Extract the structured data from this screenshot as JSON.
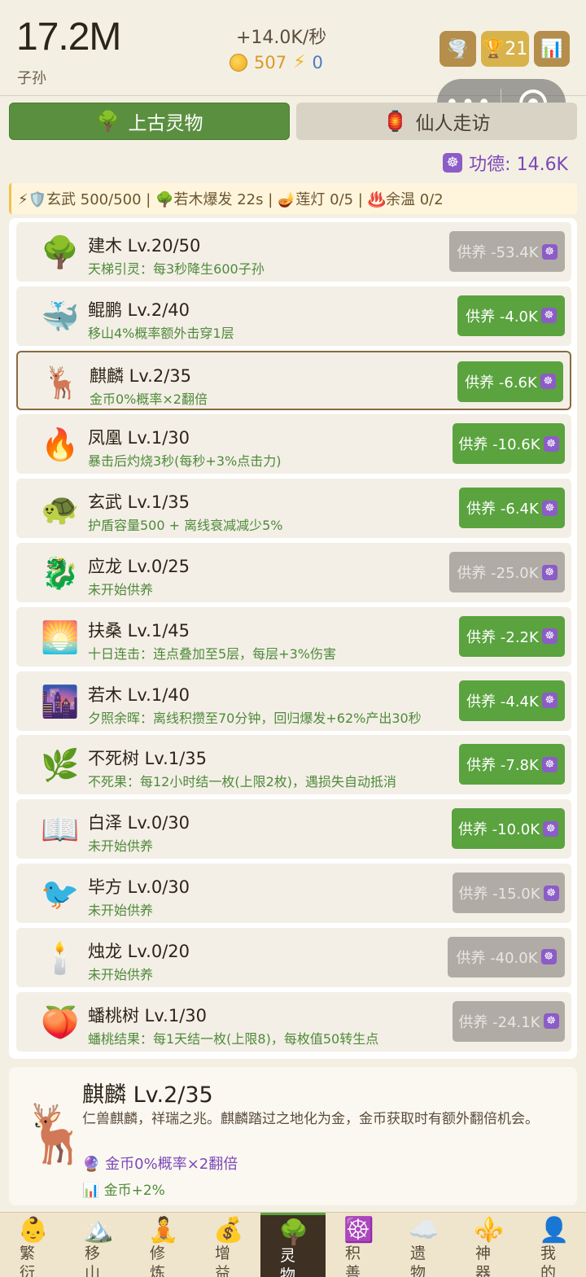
{
  "header": {
    "total": "17.2M",
    "total_label": "子孙",
    "rate": "+14.0K/秒",
    "coins": "507",
    "energy": "0",
    "trophy_count": "21"
  },
  "capsule": {
    "menu_dots": "•••"
  },
  "tabs": [
    {
      "label": "上古灵物",
      "emoji": "🌳"
    },
    {
      "label": "仙人走访",
      "emoji": "🏮"
    }
  ],
  "merit": {
    "label": "功德: 14.6K"
  },
  "status_bar": "⚡🛡️玄武 500/500 | 🌳若木爆发 22s | 🪔莲灯 0/5 | ♨️余温 0/2",
  "items": [
    {
      "emoji": "🌳",
      "name": "建木 Lv.20/50",
      "desc": "天梯引灵：每3秒降生600子孙",
      "button": "供养 -53.4K",
      "enabled": false
    },
    {
      "emoji": "🐳",
      "name": "鲲鹏 Lv.2/40",
      "desc": "移山4%概率额外击穿1层",
      "button": "供养 -4.0K",
      "enabled": true
    },
    {
      "emoji": "🦌",
      "name": "麒麟 Lv.2/35",
      "desc": "金币0%概率×2翻倍",
      "button": "供养 -6.6K",
      "enabled": true,
      "selected": true
    },
    {
      "emoji": "🔥",
      "name": "凤凰 Lv.1/30",
      "desc": "暴击后灼烧3秒(每秒+3%点击力)",
      "button": "供养 -10.6K",
      "enabled": true
    },
    {
      "emoji": "🐢",
      "name": "玄武 Lv.1/35",
      "desc": "护盾容量500 + 离线衰减减少5%",
      "button": "供养 -6.4K",
      "enabled": true
    },
    {
      "emoji": "🐉",
      "name": "应龙 Lv.0/25",
      "desc": "未开始供养",
      "button": "供养 -25.0K",
      "enabled": false
    },
    {
      "emoji": "🌅",
      "name": "扶桑 Lv.1/45",
      "desc": "十日连击：连点叠加至5层，每层+3%伤害",
      "button": "供养 -2.2K",
      "enabled": true
    },
    {
      "emoji": "🌆",
      "name": "若木 Lv.1/40",
      "desc": "夕照余晖：离线积攒至70分钟，回归爆发+62%产出30秒",
      "button": "供养 -4.4K",
      "enabled": true
    },
    {
      "emoji": "🌿",
      "name": "不死树 Lv.1/35",
      "desc": "不死果：每12小时结一枚(上限2枚)，遇损失自动抵消",
      "button": "供养 -7.8K",
      "enabled": true
    },
    {
      "emoji": "📖",
      "name": "白泽 Lv.0/30",
      "desc": "未开始供养",
      "button": "供养 -10.0K",
      "enabled": true
    },
    {
      "emoji": "🐦",
      "name": "毕方 Lv.0/30",
      "desc": "未开始供养",
      "button": "供养 -15.0K",
      "enabled": false
    },
    {
      "emoji": "🕯️",
      "name": "烛龙 Lv.0/20",
      "desc": "未开始供养",
      "button": "供养 -40.0K",
      "enabled": false
    },
    {
      "emoji": "🍑",
      "name": "蟠桃树 Lv.1/30",
      "desc": "蟠桃结果：每1天结一枚(上限8)，每枚值50转生点",
      "button": "供养 -24.1K",
      "enabled": false
    }
  ],
  "detail": {
    "emoji": "🦌",
    "name": "麒麟  Lv.2/35",
    "desc": "仁兽麒麟，祥瑞之兆。麒麟踏过之地化为金，金币获取时有额外翻倍机会。",
    "effect": "🔮 金币0%概率×2翻倍",
    "bonus": "📊 金币+2%"
  },
  "nav": [
    {
      "emoji": "👶",
      "label": "繁衍"
    },
    {
      "emoji": "🏔️",
      "label": "移山"
    },
    {
      "emoji": "🧘",
      "label": "修炼"
    },
    {
      "emoji": "💰",
      "label": "增益"
    },
    {
      "emoji": "🌳",
      "label": "灵物",
      "active": true
    },
    {
      "emoji": "☸️",
      "label": "积善"
    },
    {
      "emoji": "☁️",
      "label": "遗物"
    },
    {
      "emoji": "⚜️",
      "label": "神器"
    },
    {
      "emoji": "👤",
      "label": "我的"
    }
  ],
  "colors": {
    "accent_green": "#5a8f3f",
    "button_green": "#5aa33f",
    "merit_purple": "#7b49b8",
    "disabled_gray": "#b0aca5"
  }
}
